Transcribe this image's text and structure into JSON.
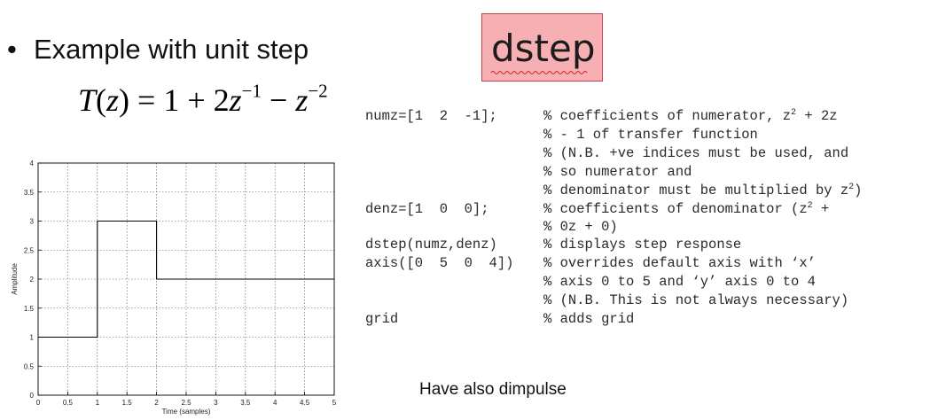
{
  "slide": {
    "bullet": "Example with unit step",
    "formula": {
      "lhs": "T",
      "var": "z",
      "eq": " = 1 + 2",
      "exp1": "−1",
      "minus": " − ",
      "exp2": "−2"
    },
    "badge": "dstep",
    "footer_note": "Have also dimpulse"
  },
  "code": {
    "commands": [
      "numz=[1  2  -1];",
      "denz=[1  0  0];",
      "dstep(numz,denz)",
      "axis([0  5  0  4])",
      "grid"
    ],
    "comments": [
      "% coefficients of numerator, z",
      "% - 1 of transfer function",
      "% (N.B. +ve indices must be used, and",
      "% so numerator and",
      "% denominator must be multiplied by z",
      "% coefficients of denominator (z",
      "% 0z + 0)",
      "% displays step response",
      "% overrides default axis with ‘x’",
      "% axis 0 to 5 and ‘y’ axis 0 to 4",
      "% (N.B. This is not always necessary)",
      "% adds grid"
    ],
    "comment_tails": {
      "line0_sup": "2",
      "line0_rest": " + 2z",
      "line4_sup": "2",
      "line4_rest": ")",
      "line5_sup": "2",
      "line5_rest": " +"
    }
  },
  "chart_data": {
    "type": "line",
    "title": "",
    "xlabel": "Time (samples)",
    "ylabel": "Amplitude",
    "xlim": [
      0,
      5
    ],
    "ylim": [
      0,
      4
    ],
    "grid": true,
    "x_ticks": [
      "0",
      "0.5",
      "1",
      "1.5",
      "2",
      "2.5",
      "3",
      "3.5",
      "4",
      "4.5",
      "5"
    ],
    "y_ticks": [
      "0",
      "0.5",
      "1",
      "1.5",
      "2",
      "2.5",
      "3",
      "3.5",
      "4"
    ],
    "series": [
      {
        "step": "post",
        "x": [
          0,
          1,
          2,
          5
        ],
        "y": [
          1,
          3,
          2,
          2
        ]
      }
    ],
    "colors": {
      "line": "#000000",
      "grid": "#555555"
    }
  }
}
